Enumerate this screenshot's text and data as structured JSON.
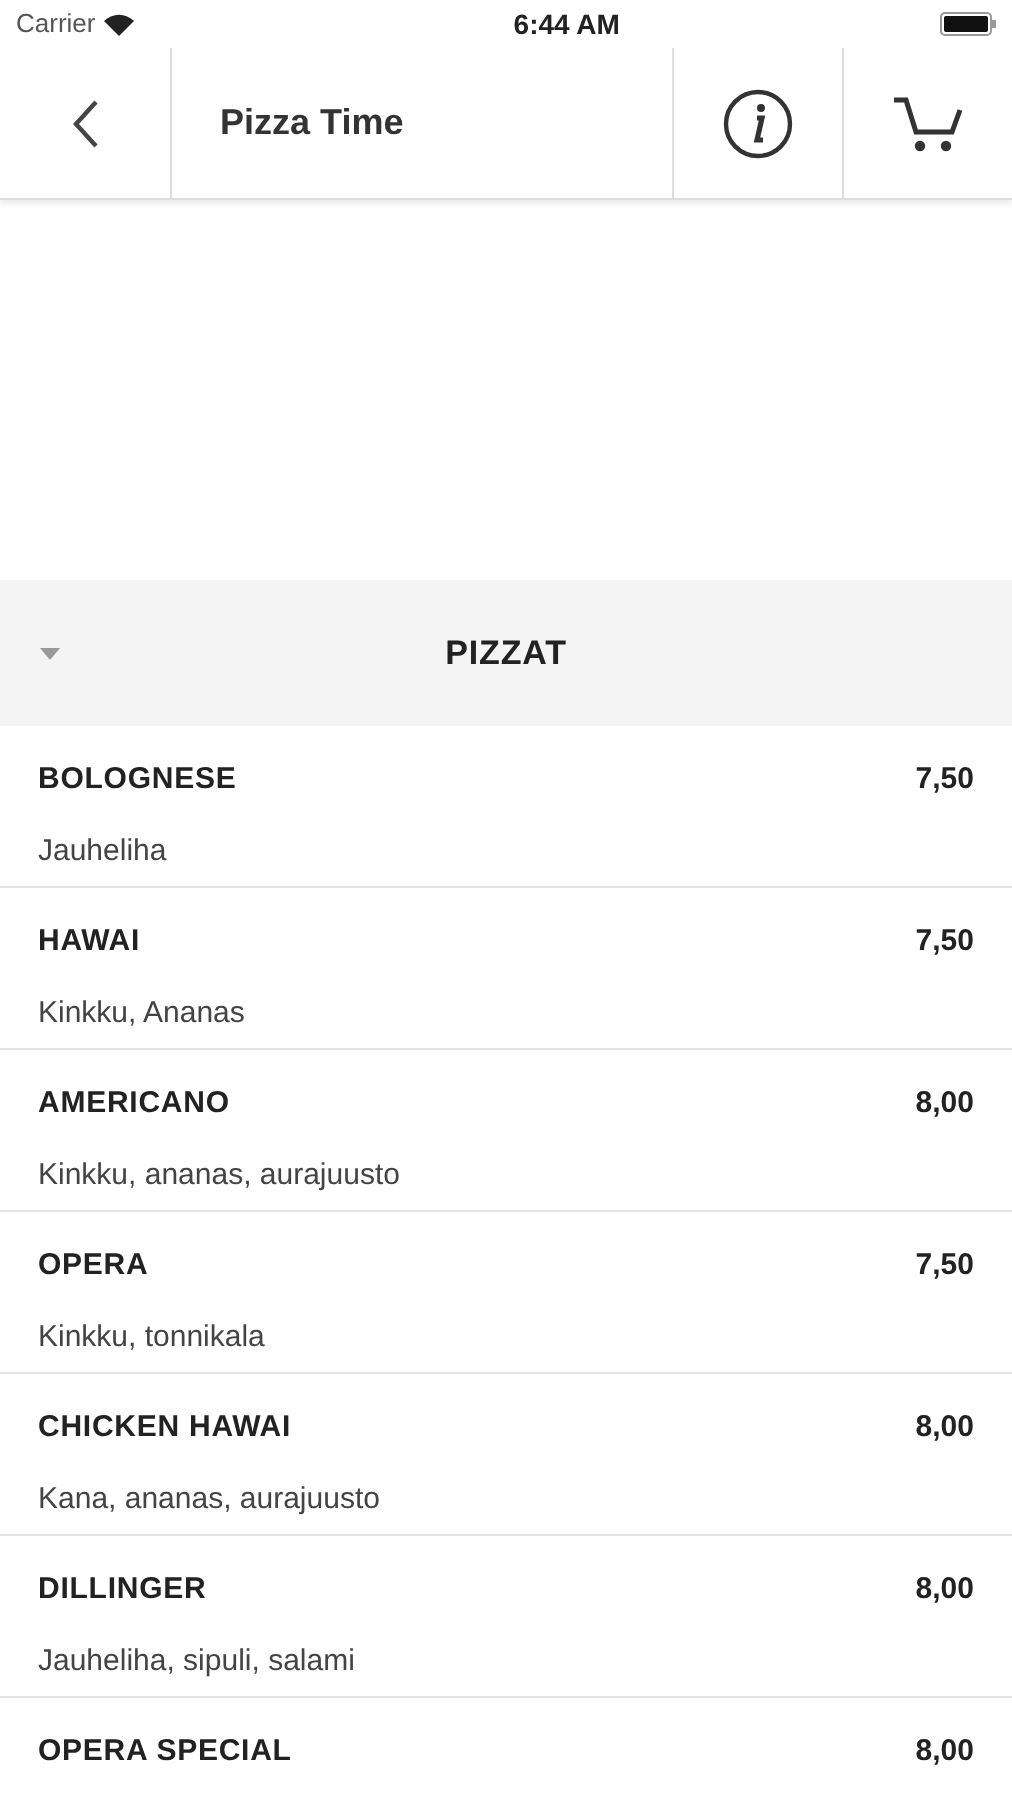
{
  "status_bar": {
    "carrier": "Carrier",
    "time": "6:44 AM"
  },
  "nav_bar": {
    "title": "Pizza Time"
  },
  "section": {
    "title": "PIZZAT",
    "expanded": true
  },
  "items": [
    {
      "name": "BOLOGNESE",
      "price": "7,50",
      "description": "Jauheliha"
    },
    {
      "name": "HAWAI",
      "price": "7,50",
      "description": "Kinkku, Ananas"
    },
    {
      "name": "AMERICANO",
      "price": "8,00",
      "description": "Kinkku, ananas, aurajuusto"
    },
    {
      "name": "OPERA",
      "price": "7,50",
      "description": "Kinkku, tonnikala"
    },
    {
      "name": "CHICKEN HAWAI",
      "price": "8,00",
      "description": "Kana, ananas, aurajuusto"
    },
    {
      "name": "DILLINGER",
      "price": "8,00",
      "description": "Jauheliha, sipuli, salami"
    },
    {
      "name": "OPERA SPECIAL",
      "price": "8,00"
    }
  ]
}
